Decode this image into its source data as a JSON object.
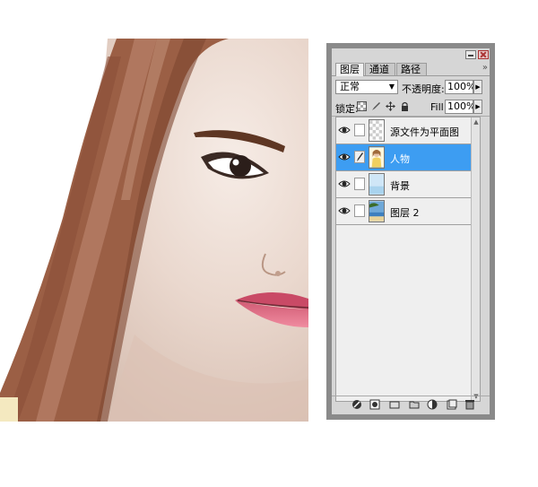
{
  "panel": {
    "tabs": [
      "图层",
      "通道",
      "路径"
    ],
    "menu_arrows": "»",
    "blend_mode": "正常",
    "opacity_label": "不透明度:",
    "opacity_value": "100%",
    "lock_label": "锁定:",
    "fill_label": "Fill:",
    "fill_value": "100%"
  },
  "layers": [
    {
      "name": "源文件为平面图",
      "visible": true,
      "selected": false,
      "thumbnail": "transparent"
    },
    {
      "name": "人物",
      "visible": true,
      "selected": true,
      "thumbnail": "figure"
    },
    {
      "name": "背景",
      "visible": true,
      "selected": false,
      "thumbnail": "sky"
    },
    {
      "name": "图层 2",
      "visible": true,
      "selected": false,
      "thumbnail": "beach"
    }
  ],
  "colors": {
    "selection": "#3d9df2",
    "panel_bg": "#d6d6d6",
    "panel_frame": "#8a8a8a",
    "skin": "#ead7cd",
    "hair": "#9b5f45",
    "lips": "#e0788e"
  },
  "icons": {
    "toolbar": [
      "link-layers-icon",
      "add-style-icon",
      "add-mask-icon",
      "new-group-icon",
      "adjustment-layer-icon",
      "new-layer-icon",
      "delete-layer-icon"
    ]
  }
}
